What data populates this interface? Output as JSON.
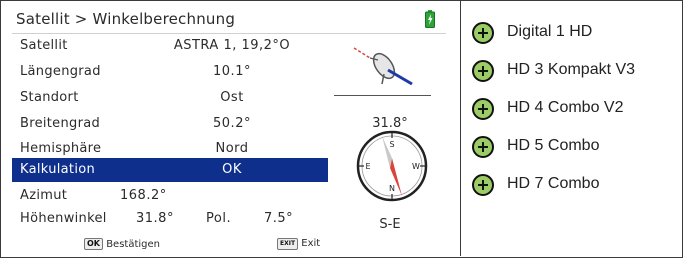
{
  "screen": {
    "title": "Satellit > Winkelberechnung",
    "rows": [
      {
        "label": "Satellit",
        "value": "ASTRA 1, 19,2°O"
      },
      {
        "label": "Längengrad",
        "value": "10.1°"
      },
      {
        "label": "Standort",
        "value": "Ost"
      },
      {
        "label": "Breitengrad",
        "value": "50.2°"
      },
      {
        "label": "Hemisphäre",
        "value": "Nord"
      },
      {
        "label": "Kalkulation",
        "value": "OK"
      }
    ],
    "azimut": {
      "label": "Azimut",
      "value": "168.2°"
    },
    "elevation": {
      "label": "Höhenwinkel",
      "value": "31.8°"
    },
    "polarization": {
      "label": "Pol.",
      "value": "7.5°"
    },
    "dish_elevation": "31.8°",
    "compass": {
      "n": "N",
      "s": "S",
      "e": "E",
      "w": "W",
      "direction": "S-E"
    },
    "footer": {
      "ok_key": "OK",
      "ok_label": "Bestätigen",
      "exit_key": "EXIT",
      "exit_label": "Exit"
    },
    "colors": {
      "selected_row": "#0f2f8c",
      "battery": "#2ea33a",
      "needle": "#d9453c"
    }
  },
  "models": [
    {
      "label": "Digital 1 HD"
    },
    {
      "label": "HD 3 Kompakt V3"
    },
    {
      "label": "HD 4 Combo V2"
    },
    {
      "label": "HD 5 Combo"
    },
    {
      "label": "HD 7 Combo"
    }
  ],
  "icons": {
    "model": "plus-circle-icon",
    "battery": "battery-charging-icon",
    "dish": "satellite-dish-icon",
    "compass": "compass-icon"
  }
}
